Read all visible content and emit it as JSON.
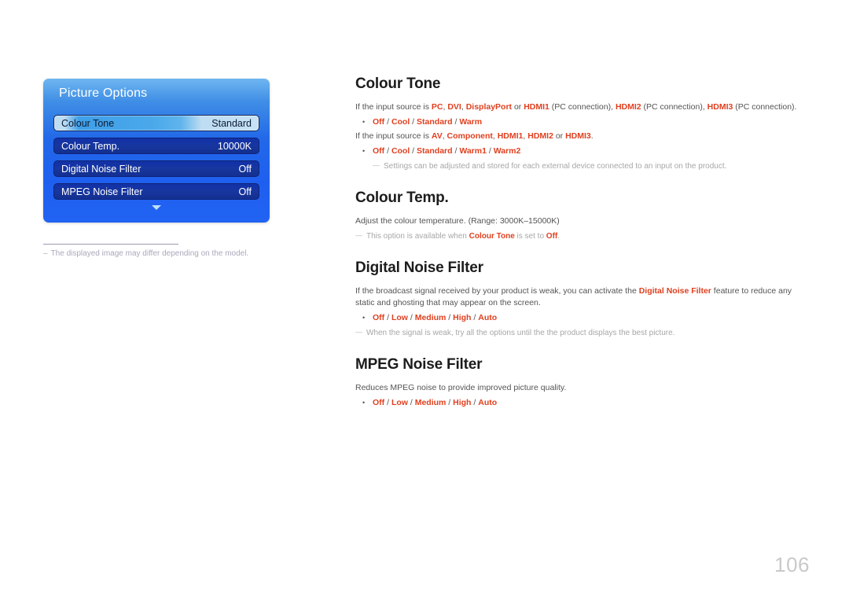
{
  "osd": {
    "title": "Picture Options",
    "more_indicator": "chevron-down-icon",
    "rows": [
      {
        "label": "Colour Tone",
        "value": "Standard",
        "selected": true
      },
      {
        "label": "Colour Temp.",
        "value": "10000K",
        "selected": false
      },
      {
        "label": "Digital Noise Filter",
        "value": "Off",
        "selected": false
      },
      {
        "label": "MPEG Noise Filter",
        "value": "Off",
        "selected": false
      }
    ]
  },
  "image_footnote": {
    "dash": "–",
    "text": "The displayed image may differ depending on the model."
  },
  "sections": [
    {
      "heading": "Colour Tone",
      "p1_a": "If the input source is ",
      "p1_pc": "PC",
      "p1_c1": ", ",
      "p1_dvi": "DVI",
      "p1_c2": ", ",
      "p1_dp": "DisplayPort",
      "p1_or": " or ",
      "p1_h1": "HDMI1",
      "p1_pc1": " (PC connection), ",
      "p1_h2": "HDMI2",
      "p1_pc2": " (PC connection), ",
      "p1_h3": "HDMI3",
      "p1_pc3": " (PC connection).",
      "bullet1": [
        "Off",
        "Cool",
        "Standard",
        "Warm"
      ],
      "p2_a": "If the input source is ",
      "p2_av": "AV",
      "p2_c1": ", ",
      "p2_comp": "Component",
      "p2_c2": ", ",
      "p2_h1": "HDMI1",
      "p2_c3": ", ",
      "p2_h2": "HDMI2",
      "p2_or": " or ",
      "p2_h3": "HDMI3",
      "p2_end": ".",
      "note1": "Settings can be adjusted and stored for each external device connected to an input on the product.",
      "bullet2": [
        "Off",
        "Cool",
        "Standard",
        "Warm1",
        "Warm2"
      ]
    },
    {
      "heading": "Colour Temp.",
      "p1": "Adjust the colour temperature. (Range: 3000K–15000K)",
      "note_a": "This option is available when ",
      "note_hl1": "Colour Tone",
      "note_b": " is set to ",
      "note_hl2": "Off",
      "note_c": "."
    },
    {
      "heading": "Digital Noise Filter",
      "p1_a": "If the broadcast signal received by your product is weak, you can activate the ",
      "p1_hl": "Digital Noise Filter",
      "p1_b": " feature to reduce any static and ghosting that may appear on the screen.",
      "bullet": [
        "Off",
        "Low",
        "Medium",
        "High",
        "Auto"
      ],
      "note": "When the signal is weak, try all the options until the the product displays the best picture."
    },
    {
      "heading": "MPEG Noise Filter",
      "p1": "Reduces MPEG noise to provide improved picture quality.",
      "bullet": [
        "Off",
        "Low",
        "Medium",
        "High",
        "Auto"
      ]
    }
  ],
  "page_number": "106",
  "colors": {
    "highlight": "#e0401f",
    "body_text": "#545454",
    "note_text": "#a7a7a7",
    "heading": "#1c1c1c",
    "osd_selected_text": "#0d1b33",
    "page_number": "#c9c9c9"
  }
}
